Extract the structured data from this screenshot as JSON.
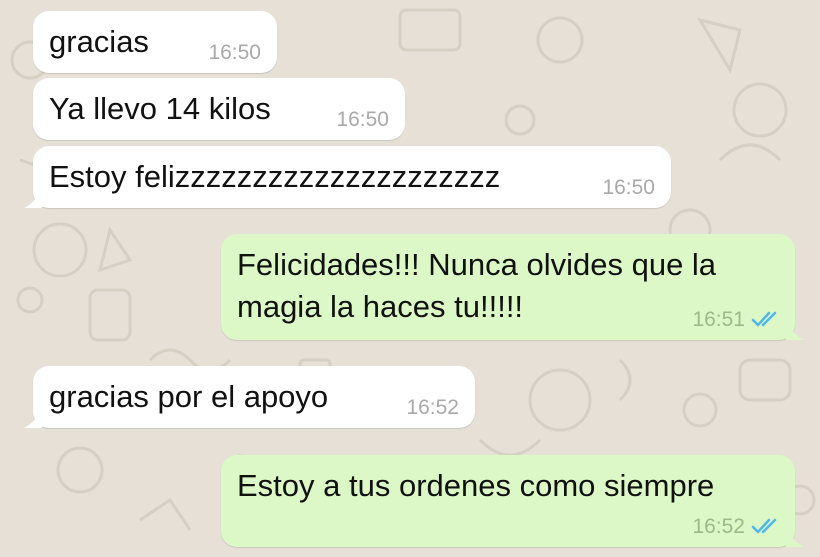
{
  "chat": {
    "messages": [
      {
        "direction": "in",
        "lines": [
          "gracias"
        ],
        "time": "16:50"
      },
      {
        "direction": "in",
        "lines": [
          "Ya llevo 14 kilos"
        ],
        "time": "16:50"
      },
      {
        "direction": "in",
        "lines": [
          "Estoy felizzzzzzzzzzzzzzzzzzzzz"
        ],
        "time": "16:50"
      },
      {
        "direction": "out",
        "lines": [
          "Felicidades!!! Nunca olvides que la",
          "magia la haces tu!!!!!"
        ],
        "time": "16:51",
        "status": "double-check-read"
      },
      {
        "direction": "in",
        "lines": [
          "gracias por el apoyo"
        ],
        "time": "16:52"
      },
      {
        "direction": "out",
        "lines": [
          "Estoy a tus ordenes como siempre"
        ],
        "time": "16:52",
        "status": "double-check-read"
      }
    ]
  },
  "colors": {
    "wallpaper": "#e6e0d6",
    "incoming_bubble": "#ffffff",
    "outgoing_bubble": "#dcf8c6",
    "read_check": "#4fb6ec",
    "timestamp": "#a9a9a9"
  },
  "icons": {
    "read_receipt": "double-check-icon"
  }
}
